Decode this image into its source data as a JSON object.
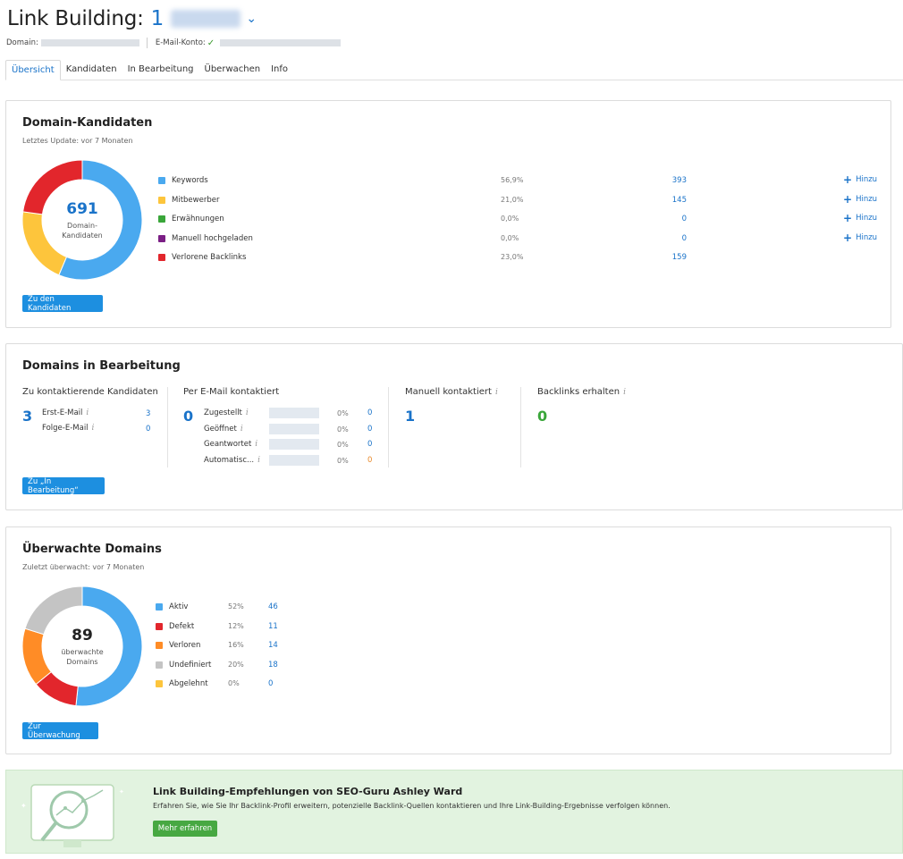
{
  "header": {
    "title": "Link Building:",
    "project_number": "1",
    "domain_label": "Domain:",
    "email_label": "E-Mail-Konto:"
  },
  "tabs": [
    "Übersicht",
    "Kandidaten",
    "In Bearbeitung",
    "Überwachen",
    "Info"
  ],
  "candidates": {
    "title": "Domain-Kandidaten",
    "subtitle": "Letztes Update: vor 7 Monaten",
    "total": "691",
    "total_label_1": "Domain-",
    "total_label_2": "Kandidaten",
    "add_label": "Hinzu",
    "button": "Zu den Kandidaten",
    "items": [
      {
        "label": "Keywords",
        "pct": "56,9%",
        "value": "393",
        "color": "#4aa9ef",
        "add": true
      },
      {
        "label": "Mitbewerber",
        "pct": "21,0%",
        "value": "145",
        "color": "#fdc53c",
        "add": true
      },
      {
        "label": "Erwähnungen",
        "pct": "0,0%",
        "value": "0",
        "color": "#3aa63a",
        "add": true
      },
      {
        "label": "Manuell hochgeladen",
        "pct": "0,0%",
        "value": "0",
        "color": "#7b1f85",
        "add": true
      },
      {
        "label": "Verlorene Backlinks",
        "pct": "23,0%",
        "value": "159",
        "color": "#e2262c",
        "add": false
      }
    ]
  },
  "inprogress": {
    "title": "Domains in Bearbeitung",
    "button": "Zu „In Bearbeitung“",
    "to_contact": {
      "head": "Zu kontaktierende Kandidaten",
      "total": "3",
      "rows": [
        {
          "label": "Erst-E-Mail",
          "value": "3"
        },
        {
          "label": "Folge-E-Mail",
          "value": "0"
        }
      ]
    },
    "email": {
      "head": "Per E-Mail kontaktiert",
      "total": "0",
      "rows": [
        {
          "label": "Zugestellt",
          "pct": "0%",
          "value": "0"
        },
        {
          "label": "Geöffnet",
          "pct": "0%",
          "value": "0"
        },
        {
          "label": "Geantwortet",
          "pct": "0%",
          "value": "0"
        },
        {
          "label": "Automatisc...",
          "pct": "0%",
          "value": "0"
        }
      ]
    },
    "manual": {
      "head": "Manuell kontaktiert",
      "total": "1"
    },
    "backlinks": {
      "head": "Backlinks erhalten",
      "total": "0"
    }
  },
  "monitored": {
    "title": "Überwachte Domains",
    "subtitle": "Zuletzt überwacht: vor 7 Monaten",
    "total": "89",
    "total_label_1": "überwachte",
    "total_label_2": "Domains",
    "button": "Zur Überwachung",
    "items": [
      {
        "label": "Aktiv",
        "pct": "52%",
        "value": "46",
        "color": "#4aa9ef"
      },
      {
        "label": "Defekt",
        "pct": "12%",
        "value": "11",
        "color": "#e2262c"
      },
      {
        "label": "Verloren",
        "pct": "16%",
        "value": "14",
        "color": "#ff8c26"
      },
      {
        "label": "Undefiniert",
        "pct": "20%",
        "value": "18",
        "color": "#c4c4c4"
      },
      {
        "label": "Abgelehnt",
        "pct": "0%",
        "value": "0",
        "color": "#fdc53c"
      }
    ]
  },
  "promo": {
    "title": "Link Building-Empfehlungen von SEO-Guru Ashley Ward",
    "text": "Erfahren Sie, wie Sie Ihr Backlink-Profil erweitern, potenzielle Backlink-Quellen kontaktieren und Ihre Link-Building-Ergebnisse verfolgen können.",
    "button": "Mehr erfahren"
  }
}
